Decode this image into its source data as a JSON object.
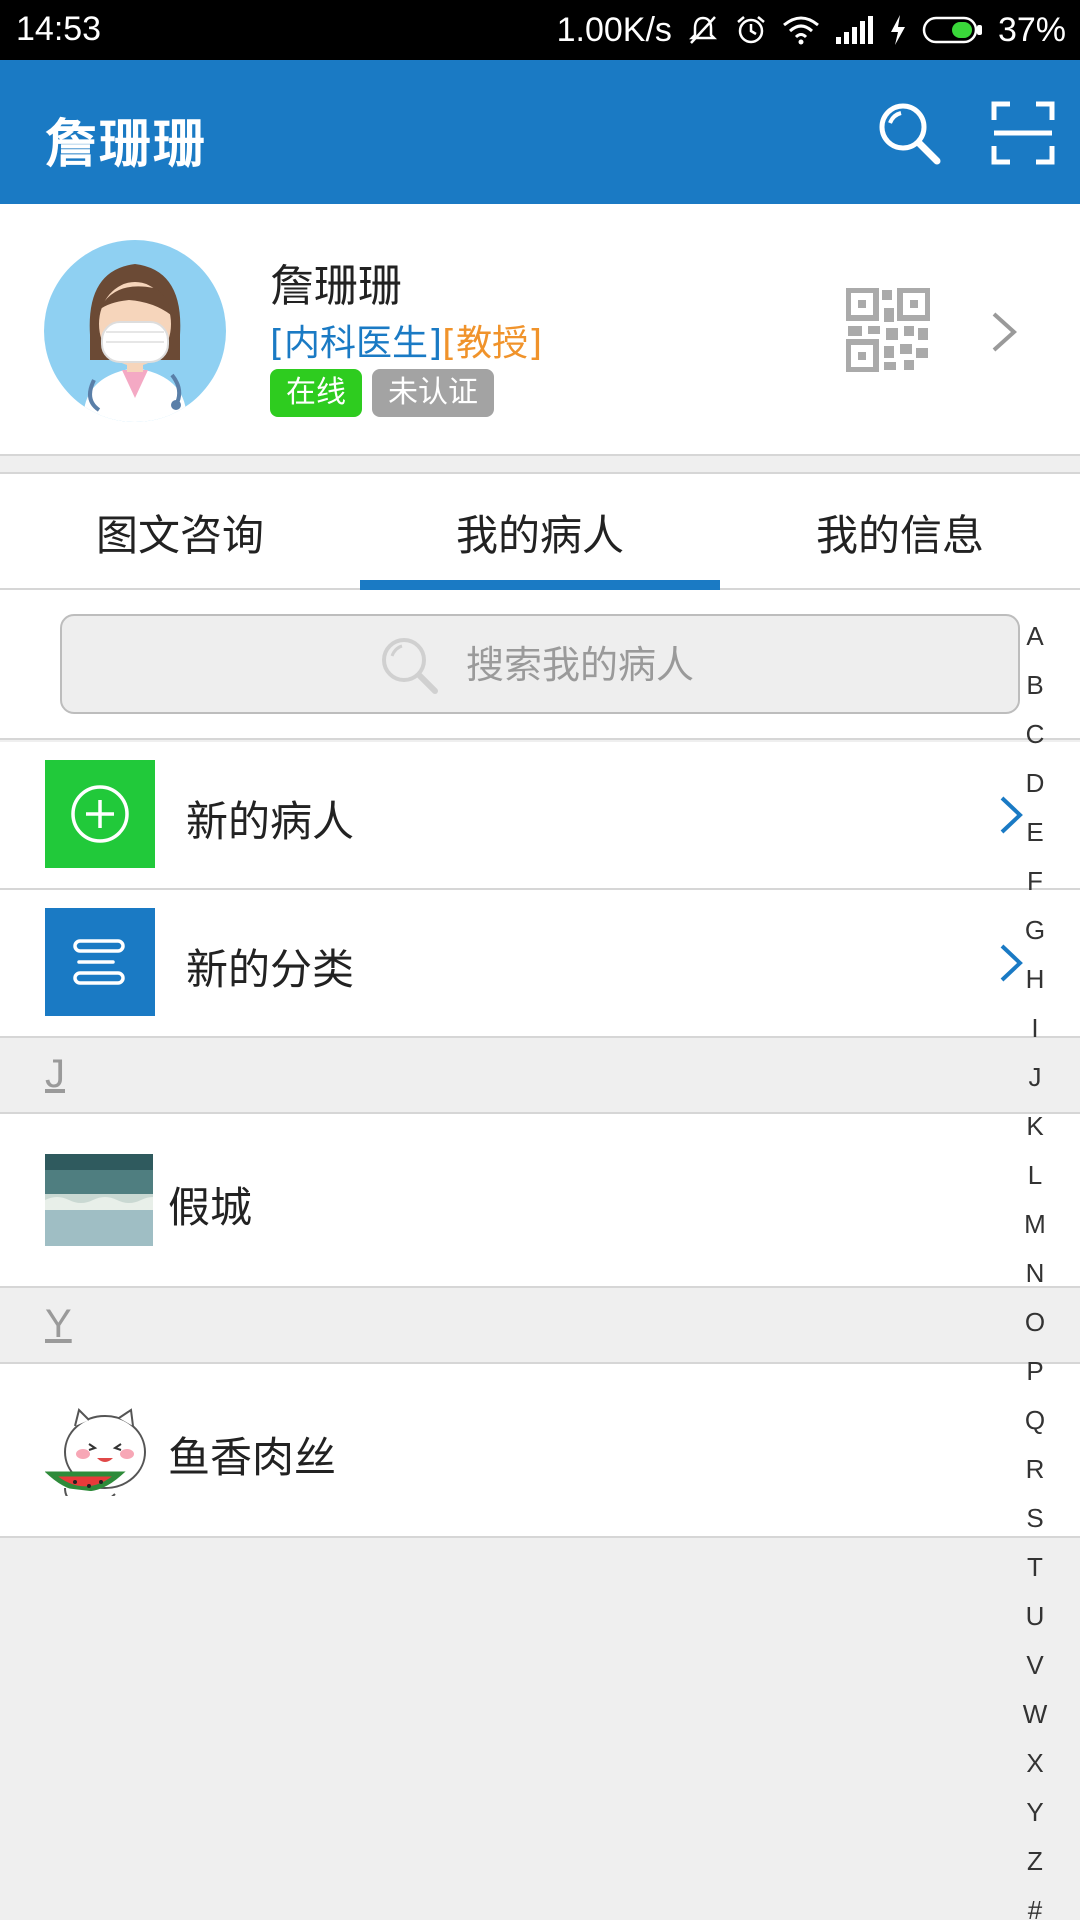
{
  "status_bar": {
    "time": "14:53",
    "net_speed": "1.00K/s",
    "battery": "37%"
  },
  "header": {
    "title": "詹珊珊"
  },
  "profile": {
    "name": "詹珊珊",
    "department": "[内科医生]",
    "rank": "[教授]",
    "status_online": "在线",
    "status_verify": "未认证"
  },
  "tabs": [
    {
      "label": "图文咨询",
      "active": false
    },
    {
      "label": "我的病人",
      "active": true
    },
    {
      "label": "我的信息",
      "active": false
    }
  ],
  "search": {
    "placeholder": "搜索我的病人"
  },
  "actions": [
    {
      "label": "新的病人",
      "icon": "add-circle-icon",
      "color": "#21c93a"
    },
    {
      "label": "新的分类",
      "icon": "list-lines-icon",
      "color": "#1a7ac4"
    }
  ],
  "groups": [
    {
      "letter": "J",
      "contacts": [
        {
          "name": "假城",
          "avatar": "seascape-thumbnail"
        }
      ]
    },
    {
      "letter": "Y",
      "contacts": [
        {
          "name": "鱼香肉丝",
          "avatar": "cartoon-cat-watermelon"
        }
      ]
    }
  ],
  "alphabet_index": [
    "A",
    "B",
    "C",
    "D",
    "E",
    "F",
    "G",
    "H",
    "I",
    "J",
    "K",
    "L",
    "M",
    "N",
    "O",
    "P",
    "Q",
    "R",
    "S",
    "T",
    "U",
    "V",
    "W",
    "X",
    "Y",
    "Z",
    "#"
  ],
  "colors": {
    "primary": "#1a7ac4",
    "online_green": "#2ecc1f",
    "rank_orange": "#f0932b",
    "badge_gray": "#a3a3a3"
  }
}
